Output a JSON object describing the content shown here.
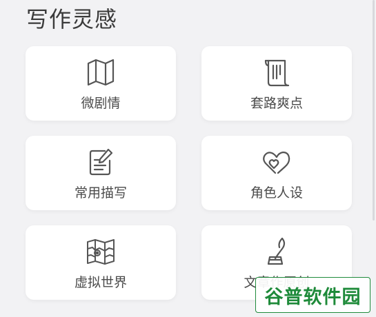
{
  "page": {
    "title": "写作灵感"
  },
  "cards": [
    {
      "label": "微剧情",
      "icon": "map-icon"
    },
    {
      "label": "套路爽点",
      "icon": "scroll-icon"
    },
    {
      "label": "常用描写",
      "icon": "edit-note-icon"
    },
    {
      "label": "角色人设",
      "icon": "hearts-icon"
    },
    {
      "label": "虚拟世界",
      "icon": "world-map-icon"
    },
    {
      "label": "文章作原创",
      "icon": "quill-ink-icon"
    }
  ],
  "watermark": {
    "text": "谷普软件园"
  },
  "colors": {
    "background": "#f2f2f4",
    "card": "#ffffff",
    "icon": "#555555",
    "watermark": "#1e8a3a"
  }
}
